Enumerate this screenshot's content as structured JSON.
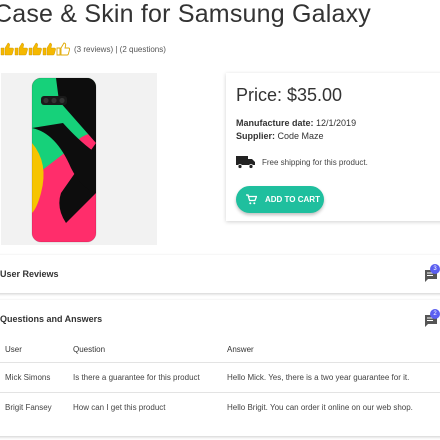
{
  "product": {
    "title": "Case & Skin for Samsung Galaxy",
    "rating": 4.5,
    "reviews_text": "(3 reviews)",
    "separator": "|",
    "questions_text": "(2 questions)"
  },
  "purchase": {
    "price": "Price: $35.00",
    "manufacture_label": "Manufacture date:",
    "manufacture_value": "12/1/2019",
    "supplier_label": "Supplier:",
    "supplier_value": "Code Maze",
    "shipping_text": "Free shipping for this product.",
    "cart_label": "ADD TO CART",
    "accent_color": "#1fbf9e"
  },
  "reviews": {
    "title": "User Reviews",
    "badge": "3",
    "icon": "comment-icon"
  },
  "questions": {
    "title": "Questions and Answers",
    "badge": "2",
    "icon": "comment-icon",
    "columns": [
      "User",
      "Question",
      "Answer"
    ],
    "rows": [
      [
        "Mick Simons",
        "Is there a guarantee for this product",
        "Hello Mick. Yes, there is a two year guarantee for it."
      ],
      [
        "Brigit Fansey",
        "How can I get this product",
        "Hello Brigit. You can order it online on our web shop."
      ]
    ]
  }
}
